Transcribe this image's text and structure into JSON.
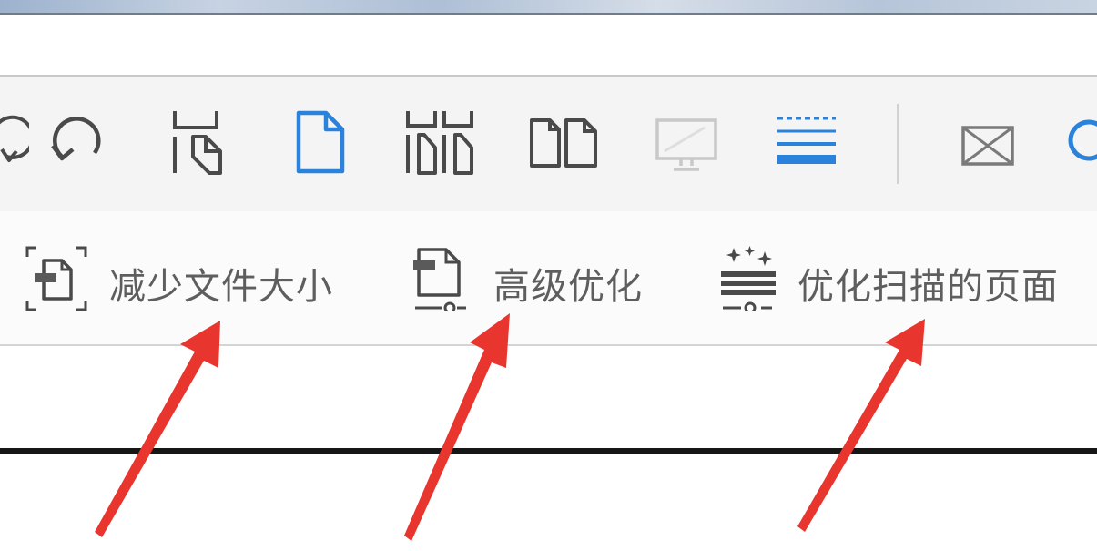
{
  "toolbar": {
    "icons": [
      {
        "name": "redo-icon"
      },
      {
        "name": "undo-icon"
      },
      {
        "name": "crop-page-icon"
      },
      {
        "name": "single-page-icon",
        "active": true
      },
      {
        "name": "multi-page-crop-icon"
      },
      {
        "name": "two-page-icon"
      },
      {
        "name": "monitor-icon"
      },
      {
        "name": "line-style-icon"
      },
      {
        "name": "mail-icon"
      },
      {
        "name": "search-icon"
      }
    ]
  },
  "ribbon": {
    "items": [
      {
        "name": "reduce-file-size-button",
        "icon": "compress-file-icon",
        "label": "减少文件大小"
      },
      {
        "name": "advanced-optimize-button",
        "icon": "advanced-optimize-icon",
        "label": "高级优化"
      },
      {
        "name": "optimize-scanned-pages-button",
        "icon": "scan-optimize-icon",
        "label": "优化扫描的页面"
      }
    ]
  },
  "colors": {
    "accent_blue": "#2a82da",
    "icon_gray": "#5a5a5a",
    "arrow_red": "#e8352e"
  }
}
